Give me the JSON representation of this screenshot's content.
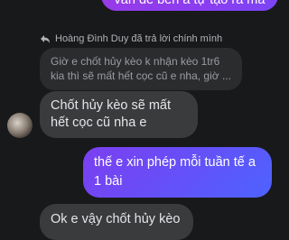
{
  "messages": {
    "top_sent": "vấn đề bên a tự tạo ra mà",
    "reply_header": "Hoàng Đình Duy đã trả lời chính mình",
    "quoted": "Giờ e chốt hủy kèo k nhận kèo 1tr6 kia thì sẽ mất hết cọc cũ e nha, giờ ...",
    "received_1": "Chốt hủy kèo sẽ mất hết cọc cũ nha e",
    "sent_1": "thế e xin phép mỗi tuần tế a 1 bài",
    "received_2": "Ok e vậy chốt hủy kèo"
  },
  "icons": {
    "reply": "reply-arrow-icon",
    "avatar": "avatar"
  },
  "colors": {
    "background": "#18191a",
    "incoming_bubble": "#3a3b3c",
    "outgoing_gradient_start": "#7b3ff0",
    "outgoing_gradient_end": "#4d63ff"
  }
}
